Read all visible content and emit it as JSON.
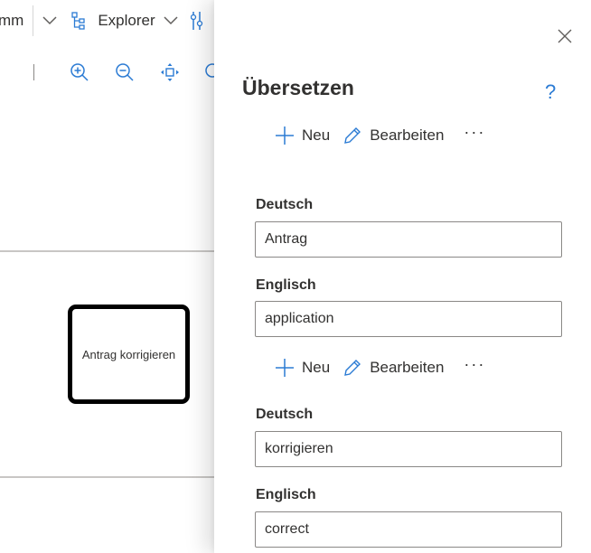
{
  "toolbar": {
    "partial_label": "mm",
    "explorer_label": "Explorer"
  },
  "diagram": {
    "task_label": "Antrag korrigieren"
  },
  "panel": {
    "title": "Übersetzen",
    "help_label": "?",
    "groups": [
      {
        "commands": {
          "new_label": "Neu",
          "edit_label": "Bearbeiten",
          "more_label": "···"
        },
        "fields": [
          {
            "label": "Deutsch",
            "value": "Antrag"
          },
          {
            "label": "Englisch",
            "value": "application"
          }
        ]
      },
      {
        "commands": {
          "new_label": "Neu",
          "edit_label": "Bearbeiten",
          "more_label": "···"
        },
        "fields": [
          {
            "label": "Deutsch",
            "value": "korrigieren"
          },
          {
            "label": "Englisch",
            "value": "correct"
          }
        ]
      }
    ]
  },
  "colors": {
    "accent": "#2b7bd4",
    "text": "#323130",
    "border": "#8a8886"
  }
}
